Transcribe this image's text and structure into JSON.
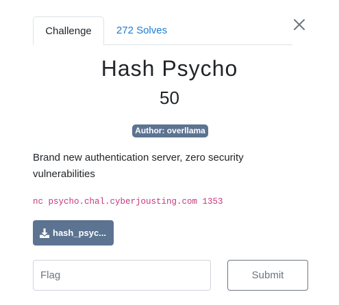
{
  "tabs": [
    {
      "label": "Challenge"
    },
    {
      "label": "272 Solves"
    }
  ],
  "challenge": {
    "name": "Hash Psycho",
    "points": "50",
    "author_badge": "Author: overllama",
    "description": "Brand new authentication server, zero security vulnerabilities",
    "connection_command": "nc psycho.chal.cyberjousting.com 1353",
    "file_label": "hash_psyc..."
  },
  "form": {
    "flag_placeholder": "Flag",
    "submit_label": "Submit"
  },
  "icons": {
    "close": "close-icon",
    "download": "download-icon"
  },
  "colors": {
    "accent_link": "#1b7bd4",
    "badge_bg": "#5c7391",
    "code_text": "#c7377e"
  }
}
